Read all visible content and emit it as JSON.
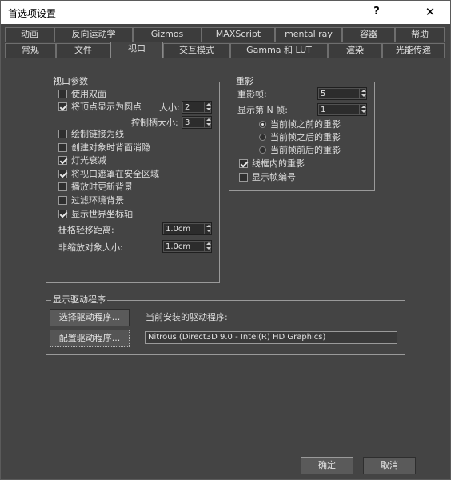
{
  "window": {
    "title": "首选项设置",
    "help_glyph": "?",
    "close_glyph": "✕"
  },
  "tabs_row1": [
    "动画",
    "反向运动学",
    "Gizmos",
    "MAXScript",
    "mental ray",
    "容器",
    "帮助"
  ],
  "tabs_row2": [
    "常规",
    "文件",
    "视口",
    "交互模式",
    "Gamma 和 LUT",
    "渲染",
    "光能传递"
  ],
  "active_tab": "视口",
  "viewport_params": {
    "group_label": "视口参数",
    "use_dual_plane": {
      "label": "使用双面",
      "checked": false
    },
    "vertex_as_dots": {
      "label": "将顶点显示为圆点",
      "checked": true
    },
    "size_label": "大小:",
    "size_value": "2",
    "handle_size_label": "控制柄大小:",
    "handle_size_value": "3",
    "draw_links_as_lines": {
      "label": "绘制链接为线",
      "checked": false
    },
    "backface_cull": {
      "label": "创建对象时背面消隐",
      "checked": false
    },
    "attenuate_lights": {
      "label": "灯光衰减",
      "checked": true
    },
    "mask_safe_region": {
      "label": "将视口遮罩在安全区域",
      "checked": true
    },
    "update_bg_playback": {
      "label": "播放时更新背景",
      "checked": false
    },
    "filter_env_bg": {
      "label": "过滤环境背景",
      "checked": false
    },
    "display_world_axis": {
      "label": "显示世界坐标轴",
      "checked": true
    },
    "grid_nudge_label": "栅格轻移距离:",
    "grid_nudge_value": "1.0cm",
    "non_scaling_label": "非缩放对象大小:",
    "non_scaling_value": "1.0cm"
  },
  "ghosting": {
    "group_label": "重影",
    "frames_label": "重影帧:",
    "frames_value": "5",
    "nth_frame_label": "显示第 N 帧:",
    "nth_frame_value": "1",
    "radio_before": {
      "label": "当前帧之前的重影",
      "checked": true
    },
    "radio_after": {
      "label": "当前帧之后的重影",
      "checked": false
    },
    "radio_both": {
      "label": "当前帧前后的重影",
      "checked": false
    },
    "wireframe": {
      "label": "线框内的重影",
      "checked": true
    },
    "show_frame_numbers": {
      "label": "显示帧编号",
      "checked": false
    }
  },
  "display_drivers": {
    "group_label": "显示驱动程序",
    "choose_button": "选择驱动程序...",
    "config_button": "配置驱动程序...",
    "current_label": "当前安装的驱动程序:",
    "current_driver": "Nitrous (Direct3D 9.0 - Intel(R) HD Graphics)"
  },
  "footer": {
    "ok_button": "确定",
    "cancel_button": "取消"
  }
}
